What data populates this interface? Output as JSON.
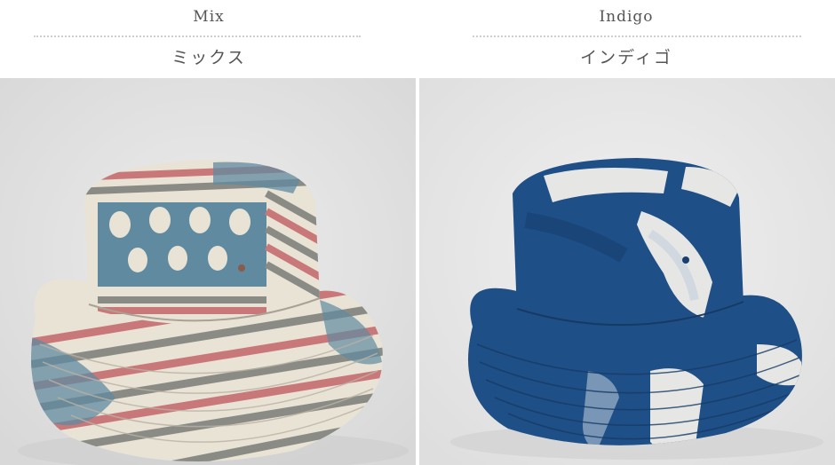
{
  "products": [
    {
      "name_en": "Mix",
      "name_ja": "ミックス",
      "image": "bucket hat with mixed red, blue and grey striped pattern",
      "colors": {
        "bg": "#e4e4e4",
        "cream": "#e9e3d6",
        "red": "#c9787a",
        "blue": "#5f8aa0",
        "grey": "#8b8b86"
      }
    },
    {
      "name_en": "Indigo",
      "name_ja": "インディゴ",
      "image": "indigo tie-dye bucket hat",
      "colors": {
        "bg": "#ececec",
        "indigo": "#1f4f87",
        "dark": "#173f70",
        "white": "#e6e7e4"
      }
    }
  ]
}
